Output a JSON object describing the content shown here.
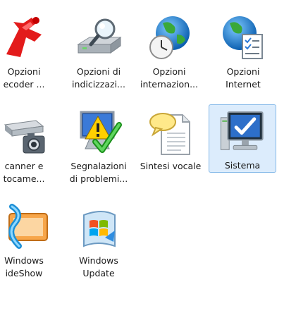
{
  "items": [
    {
      "line1": "Opzioni",
      "line2": "ecoder ...",
      "icon": "decoder-options-icon"
    },
    {
      "line1": "Opzioni di",
      "line2": "indicizzazi...",
      "icon": "indexing-options-icon"
    },
    {
      "line1": "Opzioni",
      "line2": "internazion...",
      "icon": "international-options-icon"
    },
    {
      "line1": "Opzioni",
      "line2": "Internet",
      "icon": "internet-options-icon"
    },
    {
      "line1": "canner e",
      "line2": "tocame...",
      "icon": "scanners-cameras-icon"
    },
    {
      "line1": "Segnalazioni",
      "line2": "di problemi...",
      "icon": "problem-reports-icon"
    },
    {
      "line1": "Sintesi vocale",
      "line2": "",
      "icon": "speech-synthesis-icon"
    },
    {
      "line1": "Sistema",
      "line2": "",
      "icon": "system-icon",
      "selected": true
    },
    {
      "line1": "Windows",
      "line2": "ideShow",
      "icon": "windows-sideshow-icon"
    },
    {
      "line1": "Windows",
      "line2": "Update",
      "icon": "windows-update-icon"
    }
  ],
  "colors": {
    "selection_bg": "#dcecfc",
    "selection_border": "#84b8e8"
  }
}
